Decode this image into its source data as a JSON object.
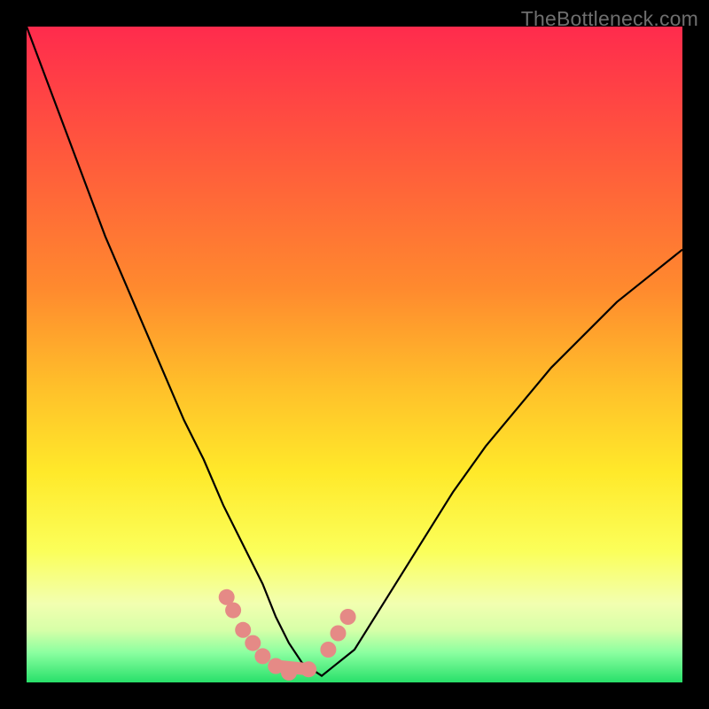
{
  "watermark": "TheBottleneck.com",
  "colors": {
    "frame": "#000000",
    "curve_stroke": "#000000",
    "marker_fill": "#e58a86",
    "green_band": "#28e06a",
    "gradient_stops": [
      {
        "offset": 0.0,
        "color": "#ff2b4d"
      },
      {
        "offset": 0.2,
        "color": "#ff5a3c"
      },
      {
        "offset": 0.4,
        "color": "#ff8a2e"
      },
      {
        "offset": 0.55,
        "color": "#ffc02a"
      },
      {
        "offset": 0.68,
        "color": "#ffe92a"
      },
      {
        "offset": 0.8,
        "color": "#fbff5a"
      },
      {
        "offset": 0.88,
        "color": "#f2ffb0"
      },
      {
        "offset": 0.92,
        "color": "#d7ffa8"
      },
      {
        "offset": 0.955,
        "color": "#8affa0"
      },
      {
        "offset": 1.0,
        "color": "#28e06a"
      }
    ]
  },
  "chart_data": {
    "type": "line",
    "title": "",
    "xlabel": "",
    "ylabel": "",
    "xlim": [
      0,
      100
    ],
    "ylim": [
      0,
      100
    ],
    "series": [
      {
        "name": "bottleneck-curve",
        "x": [
          0,
          3,
          6,
          9,
          12,
          15,
          18,
          21,
          24,
          27,
          30,
          33,
          36,
          38,
          40,
          42,
          45,
          50,
          55,
          60,
          65,
          70,
          75,
          80,
          85,
          90,
          95,
          100
        ],
        "y": [
          100,
          92,
          84,
          76,
          68,
          61,
          54,
          47,
          40,
          34,
          27,
          21,
          15,
          10,
          6,
          3,
          1,
          5,
          13,
          21,
          29,
          36,
          42,
          48,
          53,
          58,
          62,
          66
        ]
      }
    ],
    "markers": {
      "name": "highlight-markers",
      "x": [
        30.5,
        31.5,
        33.0,
        34.5,
        36.0,
        38.0,
        40.0,
        43.0,
        46.0,
        47.5,
        49.0
      ],
      "y": [
        13.0,
        11.0,
        8.0,
        6.0,
        4.0,
        2.5,
        1.5,
        2.0,
        5.0,
        7.5,
        10.0
      ]
    }
  }
}
